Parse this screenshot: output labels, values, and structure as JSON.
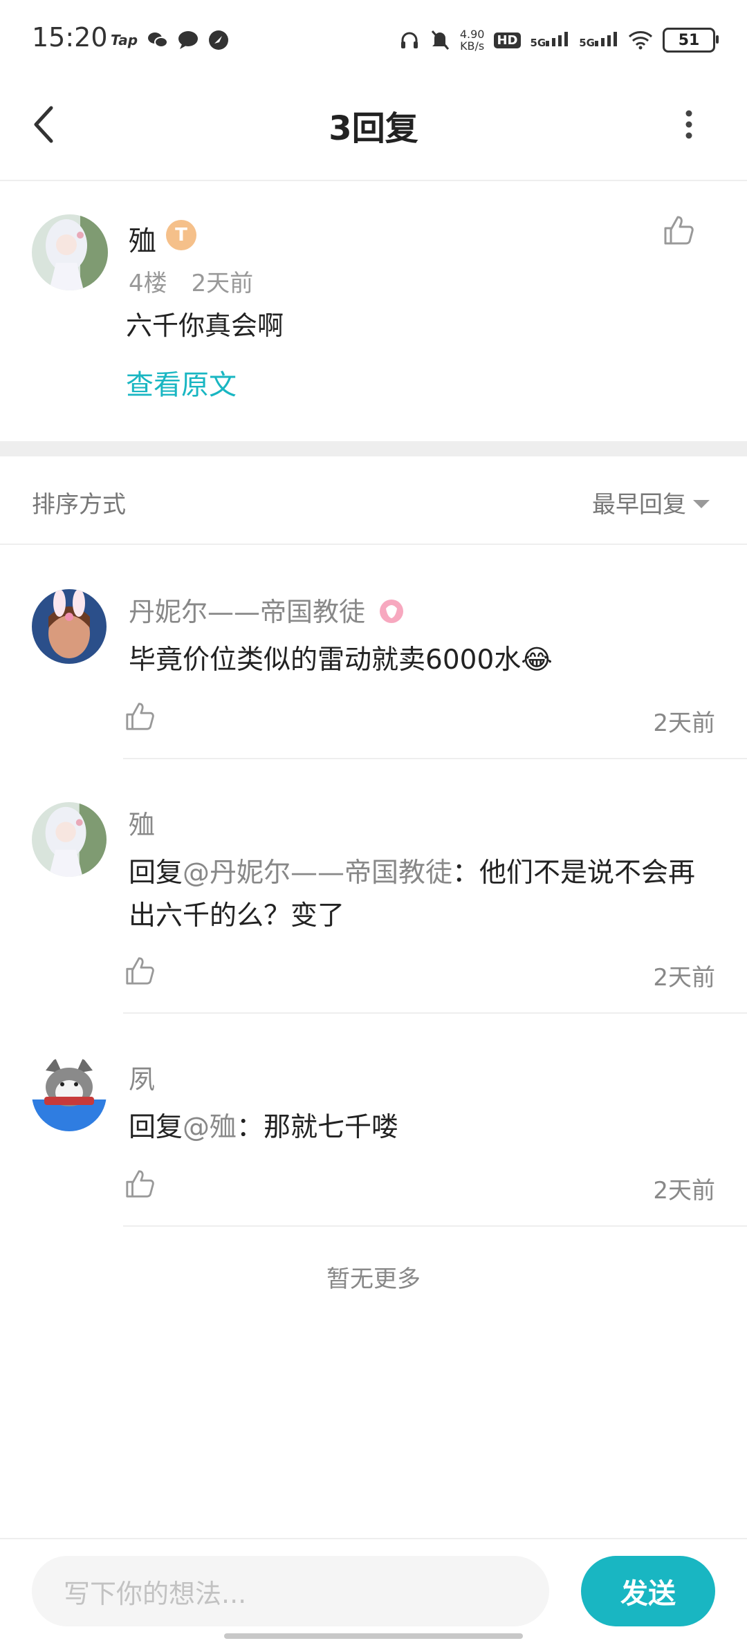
{
  "status_bar": {
    "time": "15:20",
    "speed_value": "4.90",
    "speed_unit": "KB/s",
    "hd_label": "HD",
    "net1": "5G",
    "net2": "5G",
    "battery": "51"
  },
  "header": {
    "title": "3回复"
  },
  "main_comment": {
    "username": "殈",
    "badge": "T",
    "floor": "4楼",
    "time": "2天前",
    "text": "六千你真会啊",
    "view_original": "查看原文"
  },
  "sort": {
    "label": "排序方式",
    "value": "最早回复"
  },
  "replies": [
    {
      "username": "丹妮尔——帝国教徒",
      "text": "毕竟价位类似的雷动就卖6000水😂",
      "time": "2天前"
    },
    {
      "username": "殈",
      "reply_prefix": "回复",
      "mention": "@丹妮尔——帝国教徒",
      "text": "：他们不是说不会再出六千的么？变了",
      "time": "2天前"
    },
    {
      "username": "夙",
      "reply_prefix": "回复",
      "mention": "@殈",
      "text": "：那就七千喽",
      "time": "2天前"
    }
  ],
  "footer": {
    "no_more": "暂无更多",
    "input_placeholder": "写下你的想法...",
    "send_label": "发送"
  },
  "colors": {
    "accent": "#19b6c2",
    "muted": "#888888",
    "divider": "#eeeeee"
  }
}
